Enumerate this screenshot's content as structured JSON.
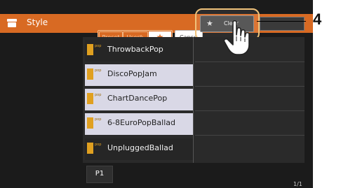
{
  "header": {
    "icon": "style-icon",
    "title": "Style",
    "filters": {
      "preset": "Preset",
      "user": "User",
      "favorite": "★"
    },
    "cancel_label": "Cance",
    "clear_label": "Clear",
    "clear_icon": "★"
  },
  "styles": [
    {
      "name": "ThrowbackPop",
      "badge": "pop",
      "selected": false
    },
    {
      "name": "DiscoPopJam",
      "badge": "pop",
      "selected": true
    },
    {
      "name": "ChartDancePop",
      "badge": "pop",
      "selected": true
    },
    {
      "name": "6-8EuroPopBallad",
      "badge": "pop",
      "selected": true
    },
    {
      "name": "UnpluggedBallad",
      "badge": "pop",
      "selected": false
    }
  ],
  "tabs": {
    "page_tab": "P1"
  },
  "page_indicator": "1/1",
  "callout": {
    "number": "4"
  },
  "colors": {
    "header": "#d86a23",
    "selected_row": "#d9d8e6",
    "highlight": "#f0c27a"
  }
}
